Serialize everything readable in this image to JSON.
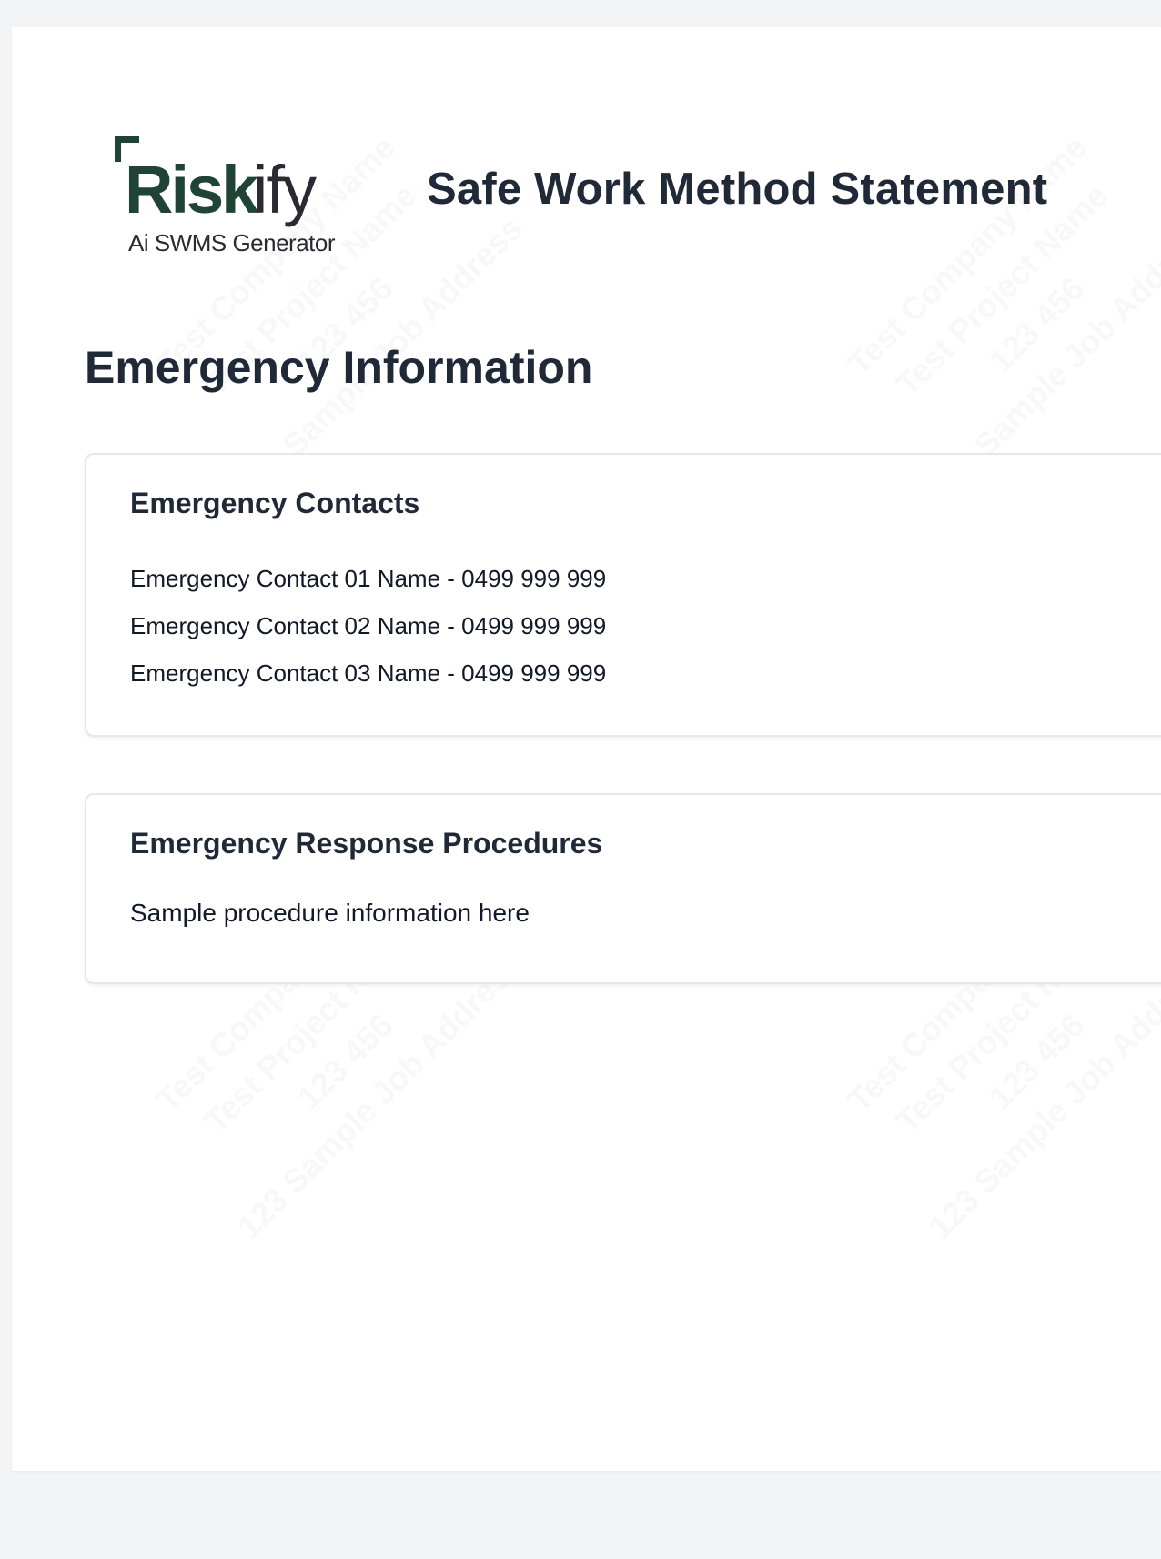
{
  "logo": {
    "brand": "Riskify",
    "tagline": "Ai SWMS Generator",
    "colors": {
      "primary": "#1f4436",
      "secondary": "#2b2a33"
    }
  },
  "document": {
    "title": "Safe Work Method Statement"
  },
  "watermark": {
    "lines": [
      "Test Company Name",
      "Test Project Name",
      "123 456",
      "123 Sample Job Address"
    ]
  },
  "section": {
    "title": "Emergency Information"
  },
  "emergency_contacts": {
    "heading": "Emergency Contacts",
    "items": [
      "Emergency Contact 01 Name - 0499 999 999",
      "Emergency Contact 02 Name - 0499 999 999",
      "Emergency Contact 03 Name - 0499 999 999"
    ]
  },
  "emergency_procedures": {
    "heading": "Emergency Response Procedures",
    "text": "Sample procedure information here"
  }
}
